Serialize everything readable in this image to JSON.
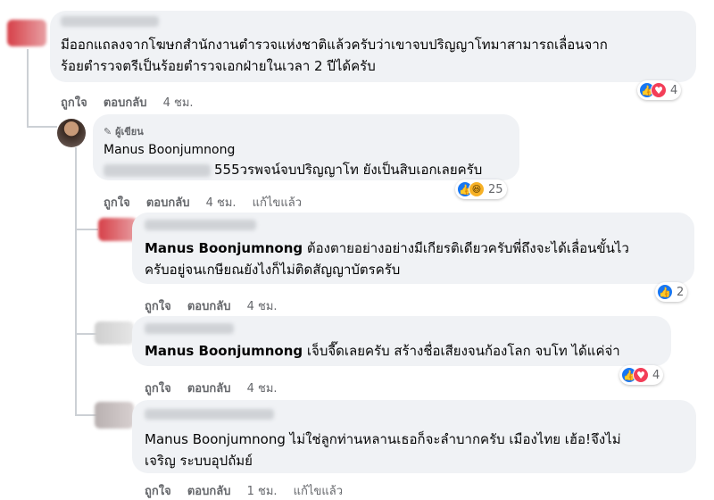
{
  "comments": [
    {
      "id": "c1",
      "text_lines": [
        "มีออกแถลงจากโฆษกสำนักงานตำรวจแห่งชาติแล้วครับว่าเขาจบปริญญาโทมาสามารถเลื่อนจาก",
        "ร้อยตำรวจตรีเป็นร้อยตำรวจเอกฝ่ายในเวลา 2 ปีได้ครับ"
      ],
      "like_label": "ถูกใจ",
      "reply_label": "ตอบกลับ",
      "time": "4 ชม.",
      "reactions": "4"
    },
    {
      "id": "c2",
      "author_badge": "ผู้เขียน",
      "author": "Manus Boonjumnong",
      "text": "555วรพจน์จบปริญญาโท ยังเป็นสิบเอกเลยครับ",
      "like_label": "ถูกใจ",
      "reply_label": "ตอบกลับ",
      "time": "4 ชม.",
      "edited": "แก้ไขแล้ว",
      "reactions": "25"
    },
    {
      "id": "c3",
      "mention": "Manus Boonjumnong",
      "text_line1": " ต้องตายอย่างอย่างมีเกียรติเดียวครับพี่ถึงจะได้เลื่อนขั้นไว",
      "text_line2": "ครับอยู่จนเกษียณยังไงก็ไม่ติดสัญญาบัตรครับ",
      "like_label": "ถูกใจ",
      "reply_label": "ตอบกลับ",
      "time": "4 ชม.",
      "reactions": "2"
    },
    {
      "id": "c4",
      "mention": "Manus Boonjumnong",
      "text": " เจ็บจี๊ดเลยครับ สร้างชื่อเสียงจนก้องโลก จบโท ได้แค่จ่า",
      "like_label": "ถูกใจ",
      "reply_label": "ตอบกลับ",
      "time": "4 ชม.",
      "reactions": "4"
    },
    {
      "id": "c5",
      "mention": "Manus Boonjumnong",
      "text_line1": " ไม่ใช่ลูกท่านหลานเธอก็จะลำบากครับ เมืองไทย เฮ้อ!จึงไม่",
      "text_line2": "เจริญ ระบบอุปถัมย์",
      "like_label": "ถูกใจ",
      "reply_label": "ตอบกลับ",
      "time": "1 ชม.",
      "edited": "แก้ไขแล้ว"
    }
  ],
  "icons": {
    "like": "like-icon",
    "love": "love-icon",
    "haha": "haha-icon",
    "author": "pencil-icon"
  },
  "colors": {
    "bubble": "#f0f2f5",
    "like_blue": "#1877f2",
    "love_red": "#f33e58",
    "haha_yellow": "#f7b125",
    "meta_gray": "#65676b"
  }
}
